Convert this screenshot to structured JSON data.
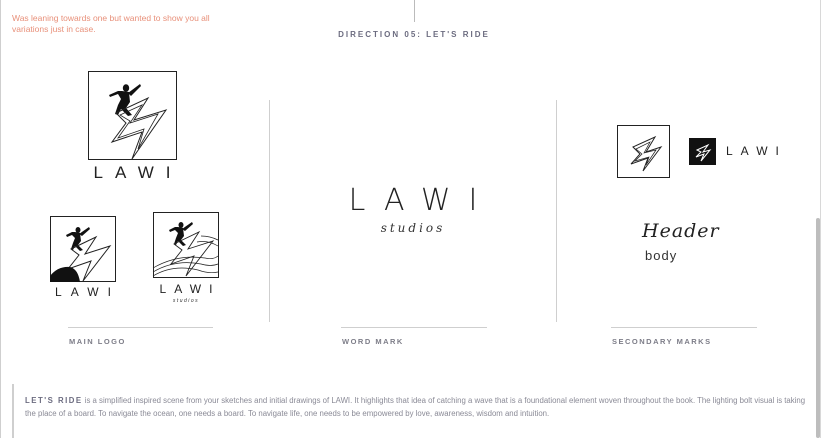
{
  "note": "Was leaning towards one but wanted to show you all variations just in case.",
  "direction_title": "DIRECTION 05: LET'S RIDE",
  "main_logo": {
    "name": "LAWI",
    "variant_solid_name": "LAWI",
    "variant_lined_name": "LAWI",
    "variant_lined_sub": "studios"
  },
  "word_mark": {
    "name": "LAWI",
    "sub": "studios"
  },
  "secondary": {
    "name": "LAWI",
    "header": "Header",
    "body": "body"
  },
  "labels": {
    "main_logo": "MAIN LOGO",
    "word_mark": "WORD MARK",
    "secondary_marks": "SECONDARY MARKS"
  },
  "description": {
    "lead": "LET'S RIDE",
    "text": " is a simplified inspired scene from your sketches and initial drawings of LAWI. It highlights that idea of catching a wave that is a foundational element woven throughout the book. The lighting bolt visual is taking the place of a board. To navigate the ocean, one needs a board. To navigate life, one needs to be empowered by love, awareness, wisdom and intuition."
  },
  "colors": {
    "note": "#e8907a",
    "label": "#7d7d88",
    "divider": "#cfcfcf"
  }
}
